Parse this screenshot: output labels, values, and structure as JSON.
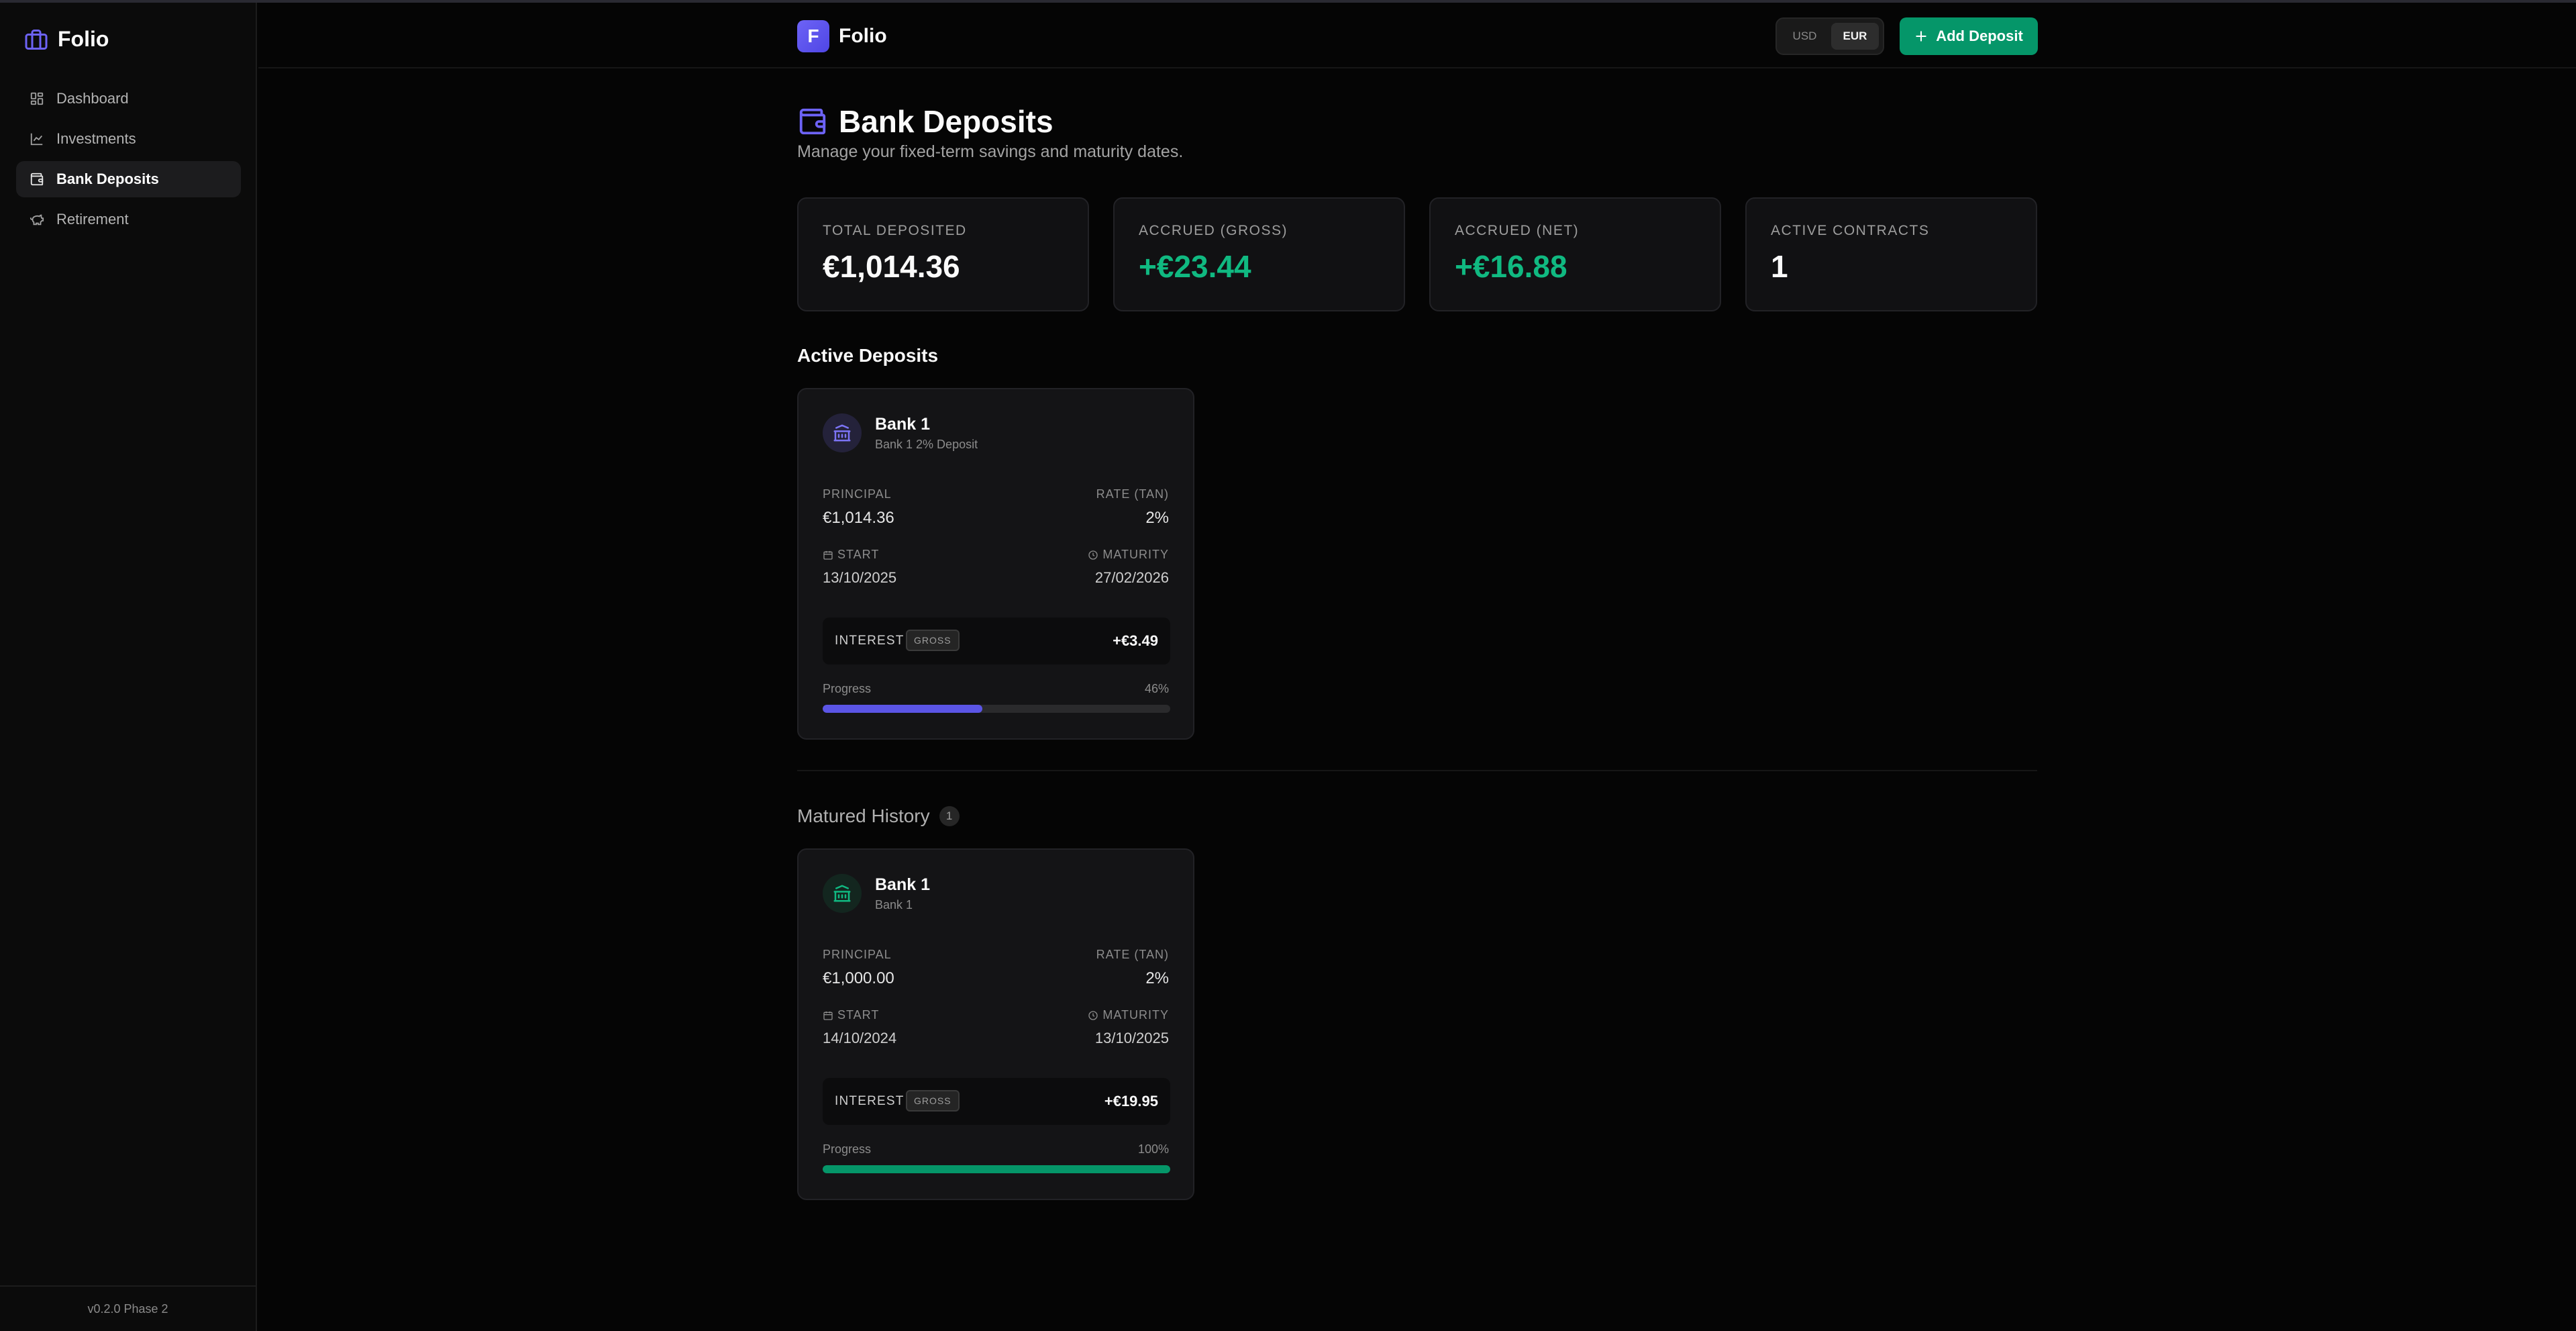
{
  "sidebar": {
    "brand": "Folio",
    "items": [
      {
        "label": "Dashboard",
        "icon": "dashboard-icon"
      },
      {
        "label": "Investments",
        "icon": "chart-line-icon"
      },
      {
        "label": "Bank Deposits",
        "icon": "wallet-icon",
        "active": true
      },
      {
        "label": "Retirement",
        "icon": "piggy-bank-icon"
      }
    ],
    "footer": "v0.2.0 Phase 2"
  },
  "header": {
    "logo_letter": "F",
    "brand": "Folio",
    "currency": {
      "options": [
        "USD",
        "EUR"
      ],
      "selected": "EUR"
    },
    "add_button": "Add Deposit"
  },
  "page": {
    "title": "Bank Deposits",
    "subtitle": "Manage your fixed-term savings and maturity dates."
  },
  "stats": [
    {
      "label": "TOTAL DEPOSITED",
      "value": "€1,014.36"
    },
    {
      "label": "ACCRUED (GROSS)",
      "value": "+€23.44"
    },
    {
      "label": "ACCRUED (NET)",
      "value": "+€16.88"
    },
    {
      "label": "ACTIVE CONTRACTS",
      "value": "1"
    }
  ],
  "active_section": {
    "title": "Active Deposits",
    "cards": [
      {
        "bank": "Bank 1",
        "subtitle": "Bank 1 2% Deposit",
        "principal_label": "PRINCIPAL",
        "principal": "€1,014.36",
        "rate_label": "RATE (TAN)",
        "rate": "2%",
        "start_label": "START",
        "start": "13/10/2025",
        "maturity_label": "MATURITY",
        "maturity": "27/02/2026",
        "interest_label": "INTEREST",
        "gross_label": "GROSS",
        "interest": "+€3.49",
        "progress_label": "Progress",
        "progress_text": "46%",
        "progress": 46
      }
    ]
  },
  "history_section": {
    "title": "Matured History",
    "count": "1",
    "cards": [
      {
        "bank": "Bank 1",
        "subtitle": "Bank 1",
        "principal_label": "PRINCIPAL",
        "principal": "€1,000.00",
        "rate_label": "RATE (TAN)",
        "rate": "2%",
        "start_label": "START",
        "start": "14/10/2024",
        "maturity_label": "MATURITY",
        "maturity": "13/10/2025",
        "interest_label": "INTEREST",
        "gross_label": "GROSS",
        "interest": "+€19.95",
        "progress_label": "Progress",
        "progress_text": "100%",
        "progress": 100
      }
    ]
  },
  "colors": {
    "accent": "#5b55e6",
    "success": "#10b981",
    "button": "#059669",
    "background": "#050505"
  }
}
